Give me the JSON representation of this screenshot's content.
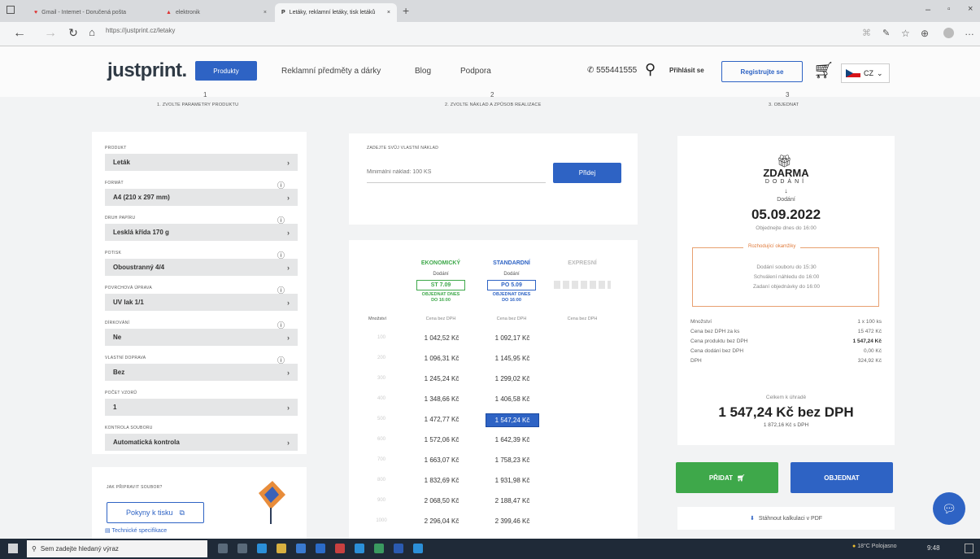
{
  "browser": {
    "tabs": [
      {
        "label": "Gmail - Internet - Doručená pošta"
      },
      {
        "label": "elektronik"
      },
      {
        "label": "Letáky, reklamní letáky, tisk letáků"
      }
    ],
    "url": "https://justprint.cz/letaky"
  },
  "header": {
    "logo": "justprint.",
    "nav_products": "Produkty",
    "nav_items": [
      "Reklamní předměty a dárky",
      "Blog",
      "Podpora"
    ],
    "phone": "555441555",
    "login": "Přihlásit se",
    "register": "Registrujte se",
    "lang": "CZ"
  },
  "steps": [
    {
      "num": "1",
      "label": "1. ZVOLTE PARAMETRY PRODUKTU"
    },
    {
      "num": "2",
      "label": "2. ZVOLTE NÁKLAD A ZPŮSOB REALIZACE"
    },
    {
      "num": "3",
      "label": "3. OBJEDNAT"
    }
  ],
  "form": {
    "fields": [
      {
        "label": "PRODUKT",
        "value": "Leták"
      },
      {
        "label": "FORMÁT",
        "value": "A4 (210 x 297 mm)"
      },
      {
        "label": "DRUH PAPÍRU",
        "value": "Lesklá křída 170 g"
      },
      {
        "label": "POTISK",
        "value": "Oboustranný 4/4"
      },
      {
        "label": "POVRCHOVÁ ÚPRAVA",
        "value": "UV lak 1/1"
      },
      {
        "label": "DÍRKOVÁNÍ",
        "value": "Ne"
      },
      {
        "label": "VLASTNÍ DOPRAVA",
        "value": "Bez"
      },
      {
        "label": "POČET VZORŮ",
        "value": "1"
      },
      {
        "label": "KONTROLA SOUBORU",
        "value": "Automatická kontrola"
      }
    ],
    "guide_label": "JAK PŘIPRAVIT SOUBOR?",
    "guide_button": "Pokyny k tisku",
    "tech_link": "Technické specifikace"
  },
  "custom_qty": {
    "label": "ZADEJTE SVŮJ VLASTNÍ NÁKLAD",
    "placeholder": "Minimální náklad: 100 KS",
    "button": "Přidej"
  },
  "pricing": {
    "columns": [
      {
        "name": "EKONOMICKÝ",
        "delivery": "Dodání",
        "date": "ST 7.09",
        "deadline": "OBJEDNAT DNES DO 16:00",
        "price_label": "Cena bez DPH",
        "color": "#3ea84a"
      },
      {
        "name": "STANDARDNÍ",
        "delivery": "Dodání",
        "date": "PO 5.09",
        "deadline": "OBJEDNAT DNES DO 16:00",
        "price_label": "Cena bez DPH",
        "color": "#2e63c4"
      },
      {
        "name": "EXPRESNÍ",
        "delivery": "",
        "date": "",
        "deadline": "",
        "price_label": "Cena bez DPH",
        "color": "#bbbbbb"
      }
    ],
    "qty_label": "Množství",
    "rows": [
      {
        "qty": "100",
        "eco": "1 042,52 Kč",
        "std": "1 092,17 Kč"
      },
      {
        "qty": "200",
        "eco": "1 096,31 Kč",
        "std": "1 145,95 Kč"
      },
      {
        "qty": "300",
        "eco": "1 245,24 Kč",
        "std": "1 299,02 Kč"
      },
      {
        "qty": "400",
        "eco": "1 348,66 Kč",
        "std": "1 406,58 Kč"
      },
      {
        "qty": "500",
        "eco": "1 472,77 Kč",
        "std": "1 547,24 Kč"
      },
      {
        "qty": "600",
        "eco": "1 572,06 Kč",
        "std": "1 642,39 Kč"
      },
      {
        "qty": "700",
        "eco": "1 663,07 Kč",
        "std": "1 758,23 Kč"
      },
      {
        "qty": "800",
        "eco": "1 832,69 Kč",
        "std": "1 931,98 Kč"
      },
      {
        "qty": "900",
        "eco": "2 068,50 Kč",
        "std": "2 188,47 Kč"
      },
      {
        "qty": "1000",
        "eco": "2 296,04 Kč",
        "std": "2 399,46 Kč"
      }
    ],
    "selected": "1 547,24 Kč"
  },
  "summary": {
    "free_title": "ZDARMA",
    "free_sub": "DODÁNÍ",
    "delivery_label": "Dodání",
    "delivery_date": "05.09.2022",
    "order_by": "Objednejte dnes do 16:00",
    "deadlines_title": "Rozhodující okamžiky",
    "deadlines": [
      "Dodání souboru do 15:30",
      "Schválení náhledu do 16:00",
      "Zadaní objednávky do 16:00"
    ],
    "rows": [
      {
        "label": "Množství",
        "value": "1 x 100 ks"
      },
      {
        "label": "Cena bez DPH za ks",
        "value": "15 472 Kč"
      },
      {
        "label": "Cena produktu bez DPH",
        "value": "1 547,24 Kč"
      },
      {
        "label": "Cena dodání bez DPH",
        "value": "0,00 Kč"
      },
      {
        "label": "DPH",
        "value": "324,92 Kč"
      }
    ],
    "total_label": "Celkem k úhradě",
    "total": "1 547,24 Kč bez DPH",
    "total_vat": "1 872,16 Kč s DPH",
    "add_button": "PŘIDAT",
    "order_button": "OBJEDNAT",
    "pdf_link": "Stáhnout kalkulaci v PDF"
  },
  "taskbar": {
    "search": "Sem zadejte hledaný výraz",
    "weather": "18°C Polojasno",
    "time": "9:48"
  }
}
